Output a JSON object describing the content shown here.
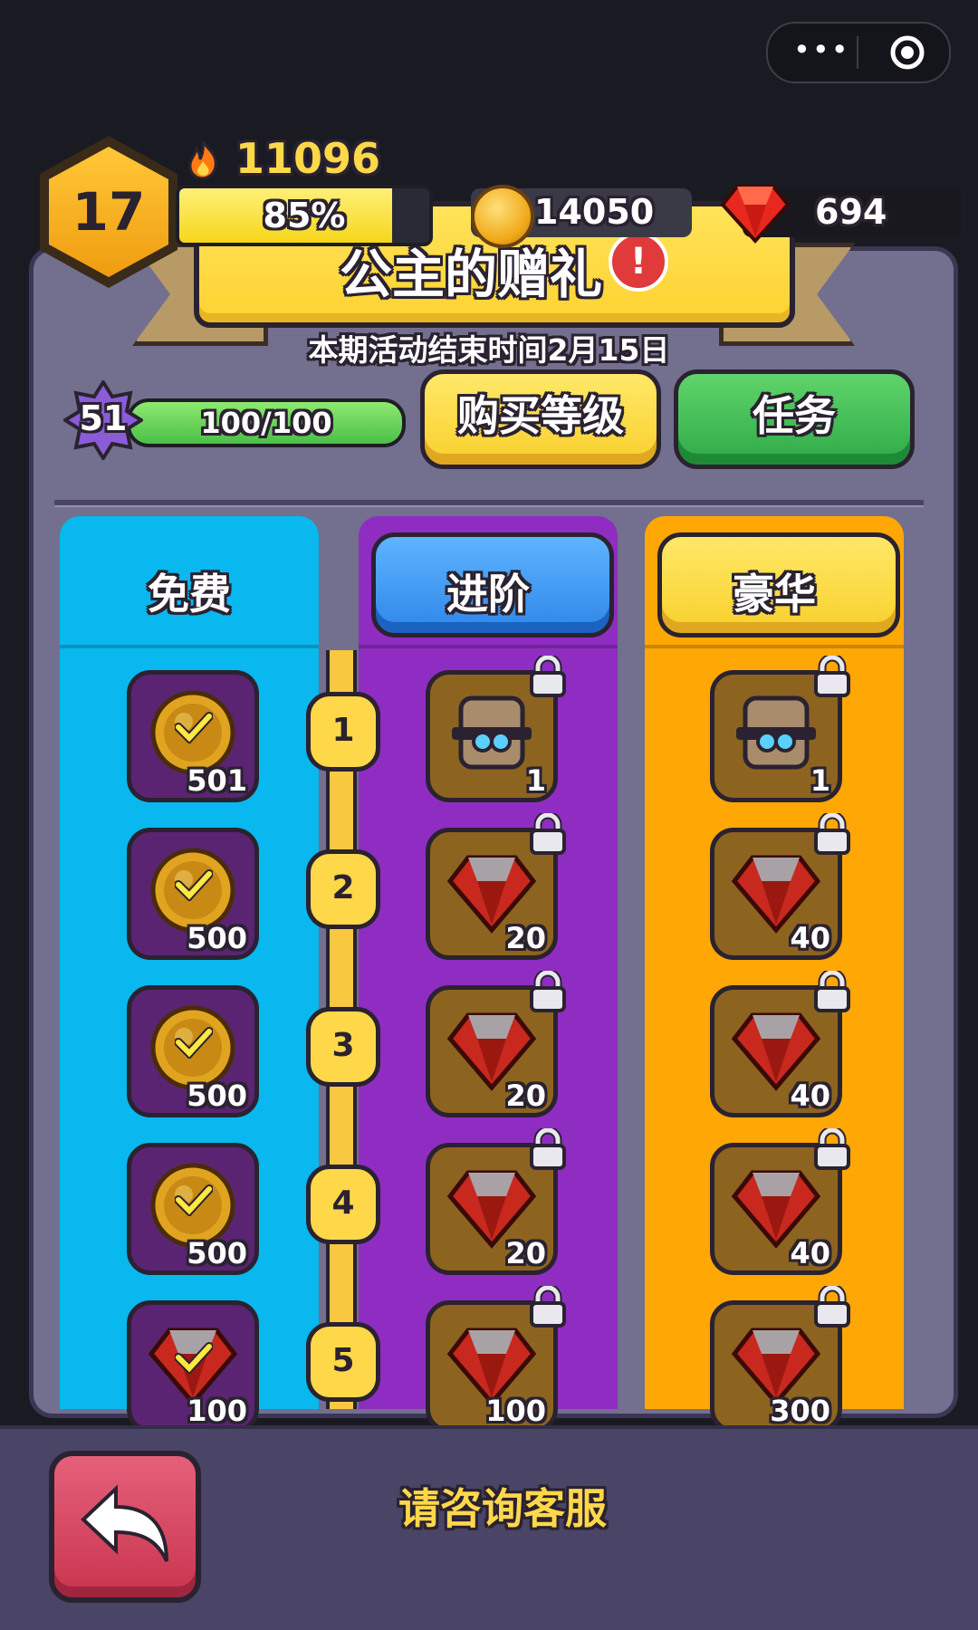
{
  "capsule": {
    "more_icon": "more-dots-icon",
    "target_icon": "target-circle-icon"
  },
  "hud": {
    "player_level": "17",
    "score": "11096",
    "xp_percent_label": "85%",
    "xp_progress": 0.85,
    "coins": "14050",
    "gems": "694"
  },
  "event": {
    "title": "公主的赠礼",
    "end_time": "本期活动结束时间2月15日"
  },
  "pass": {
    "star_level": "51",
    "progress_label": "100/100",
    "progress": 1.0,
    "buy_level_label": "购买等级",
    "task_label": "任务"
  },
  "tracks": {
    "free": "免费",
    "advanced": "进阶",
    "deluxe": "豪华"
  },
  "rows": [
    {
      "level": "1",
      "free": {
        "type": "coin",
        "amount": "501",
        "claimed": true
      },
      "advanced": {
        "type": "chest",
        "amount": "1"
      },
      "deluxe": {
        "type": "chest",
        "amount": "1"
      }
    },
    {
      "level": "2",
      "free": {
        "type": "coin",
        "amount": "500",
        "claimed": true
      },
      "advanced": {
        "type": "gem",
        "amount": "20"
      },
      "deluxe": {
        "type": "gem",
        "amount": "40"
      }
    },
    {
      "level": "3",
      "free": {
        "type": "coin",
        "amount": "500",
        "claimed": true
      },
      "advanced": {
        "type": "gem",
        "amount": "20"
      },
      "deluxe": {
        "type": "gem",
        "amount": "40"
      }
    },
    {
      "level": "4",
      "free": {
        "type": "coin",
        "amount": "500",
        "claimed": true
      },
      "advanced": {
        "type": "gem",
        "amount": "20"
      },
      "deluxe": {
        "type": "gem",
        "amount": "40"
      }
    },
    {
      "level": "5",
      "free": {
        "type": "gem",
        "amount": "100",
        "claimed": true
      },
      "advanced": {
        "type": "gem",
        "amount": "100"
      },
      "deluxe": {
        "type": "gem",
        "amount": "300"
      }
    }
  ],
  "footer": {
    "back_icon": "back-arrow-icon",
    "service_text": "请咨询客服"
  },
  "colors": {
    "free_track": "#08b8ee",
    "advanced_track": "#8f2dc2",
    "deluxe_track": "#ffa705",
    "panel": "#72708e"
  }
}
